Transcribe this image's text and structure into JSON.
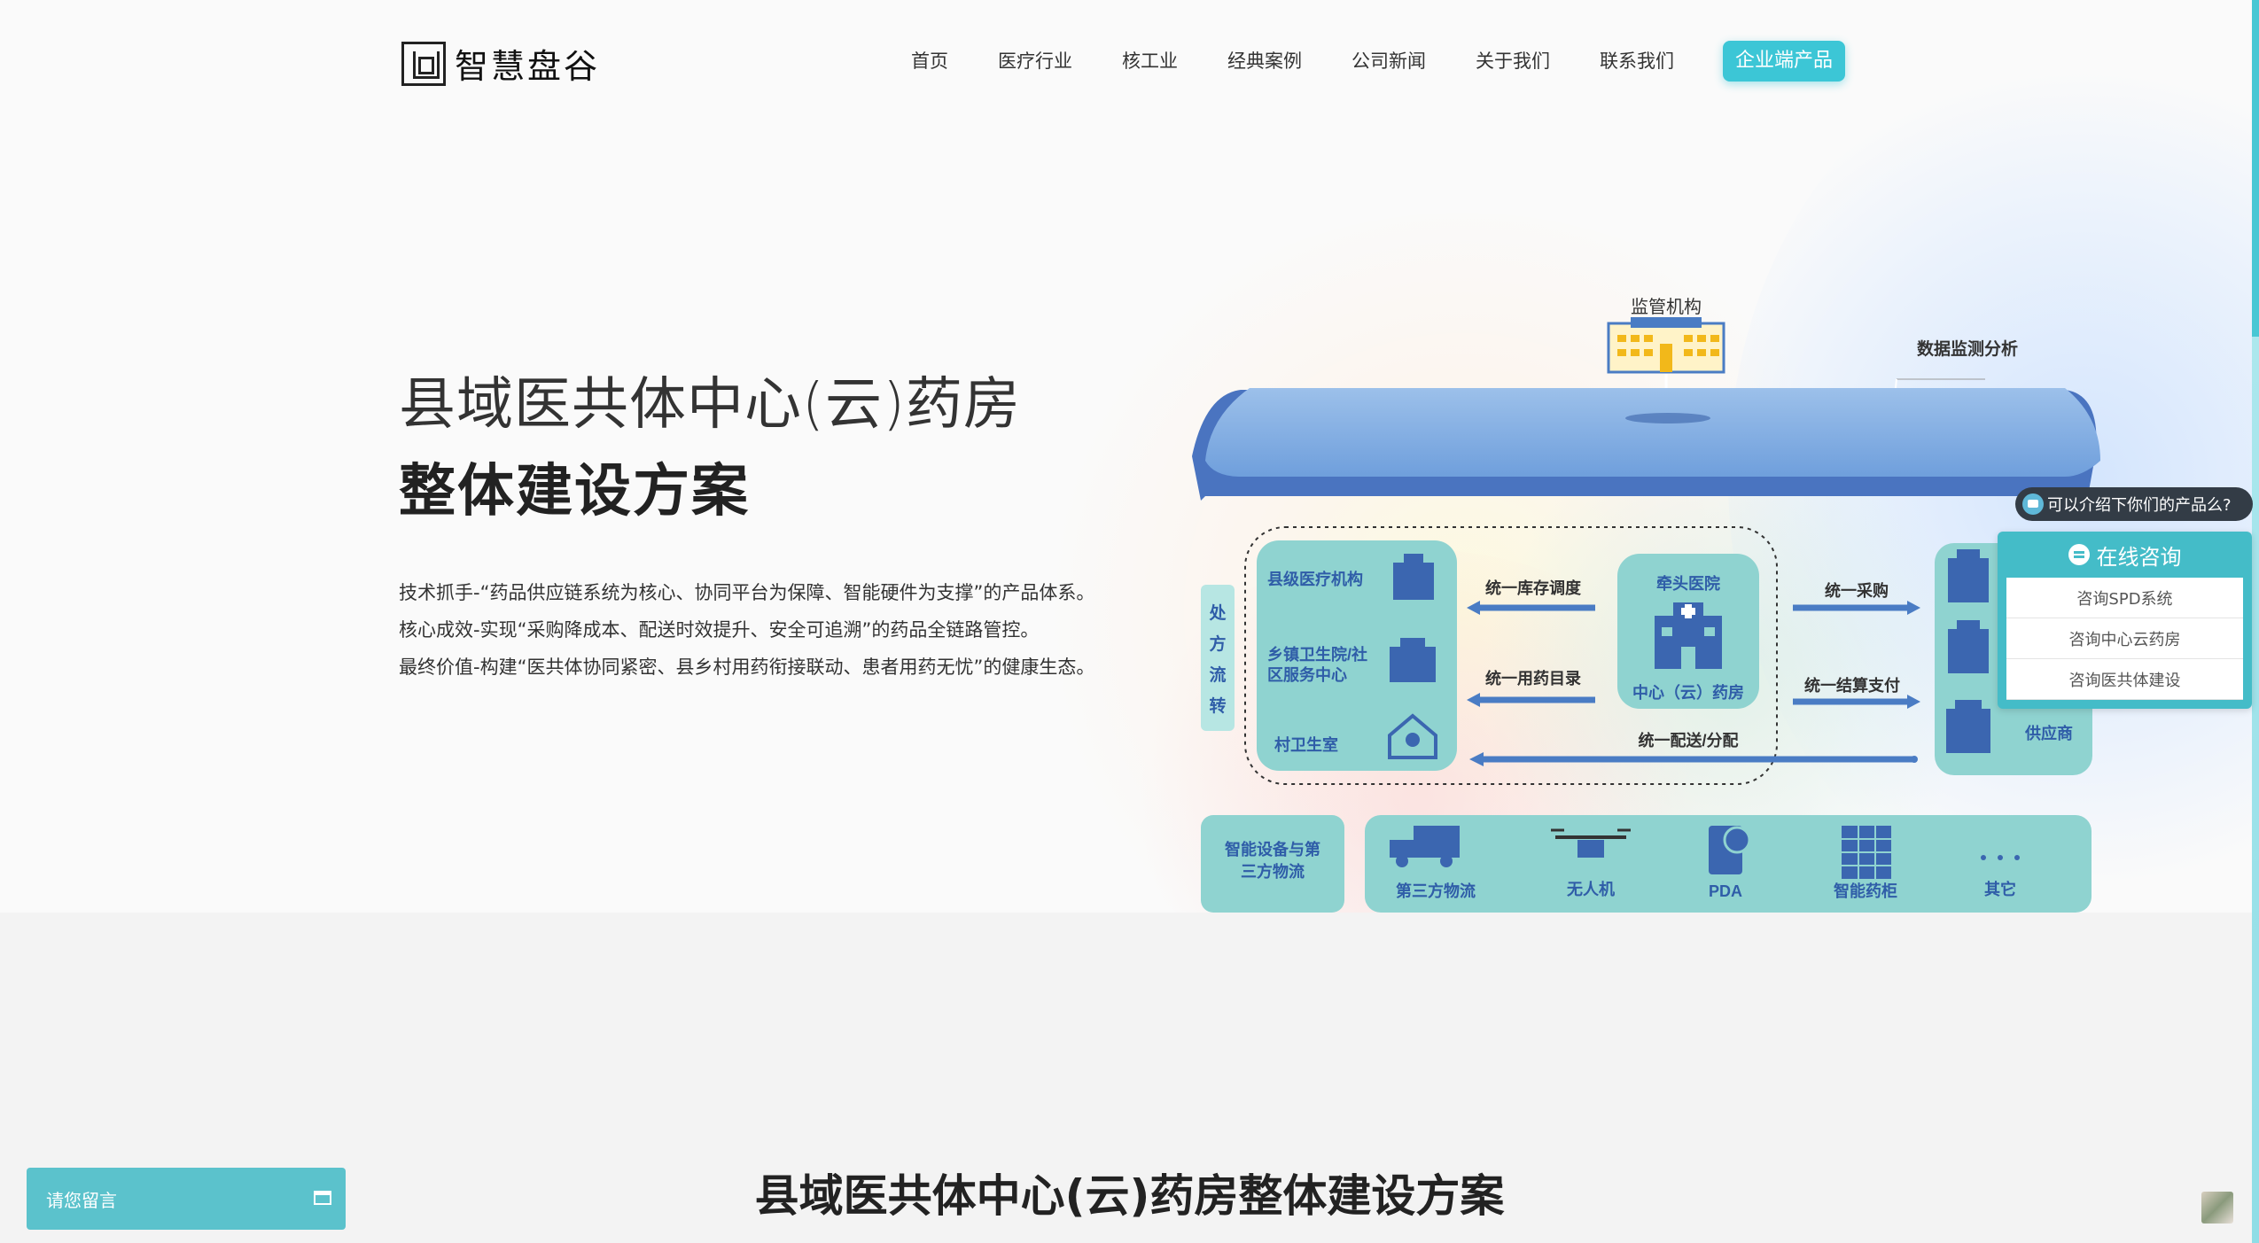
{
  "brand": {
    "name": "智慧盘谷"
  },
  "nav": {
    "items": [
      "首页",
      "医疗行业",
      "核工业",
      "经典案例",
      "公司新闻",
      "关于我们",
      "联系我们"
    ],
    "cta": "企业端产品"
  },
  "hero": {
    "title_line1": "县域医共体中心(云)药房",
    "title_line2": "整体建设方案",
    "desc": [
      "技术抓手-“药品供应链系统为核心、协同平台为保障、智能硬件为支撑”的产品体系。",
      "核心成效-实现“采购降成本、配送时效提升、安全可追溯”的药品全链路管控。",
      "最终价值-构建“医共体协同紧密、县乡村用药衔接联动、患者用药无忧”的健康生态。"
    ]
  },
  "diagram": {
    "regulator": "监管机构",
    "monitor": "数据监测分析",
    "side_label": [
      "处",
      "方",
      "流",
      "转"
    ],
    "left_nodes": [
      "县级医疗机构",
      "乡镇卫生院/社",
      "区服务中心",
      "村卫生室"
    ],
    "flows_left": [
      "统一库存调度",
      "统一用药目录",
      "统一配送/分配"
    ],
    "center_top": "牵头医院",
    "center_bottom": "中心（云）药房",
    "flows_right": [
      "统一采购",
      "统一结算支付"
    ],
    "supplier": "供应商",
    "bottom_label": [
      "智能设备与第",
      "三方物流"
    ],
    "devices": [
      "第三方物流",
      "无人机",
      "PDA",
      "智能药柜",
      "其它"
    ]
  },
  "section": {
    "title": "县域医共体中心(云)药房整体建设方案"
  },
  "chat": {
    "bubble": "可以介绍下你们的产品么?",
    "title": "在线咨询",
    "items": [
      "咨询SPD系统",
      "咨询中心云药房",
      "咨询医共体建设"
    ]
  },
  "leave_message": "请您留言",
  "colors": {
    "accent": "#3cc6d6",
    "diagram_teal": "#8fd3d0",
    "diagram_blue": "#4a7cc4"
  }
}
